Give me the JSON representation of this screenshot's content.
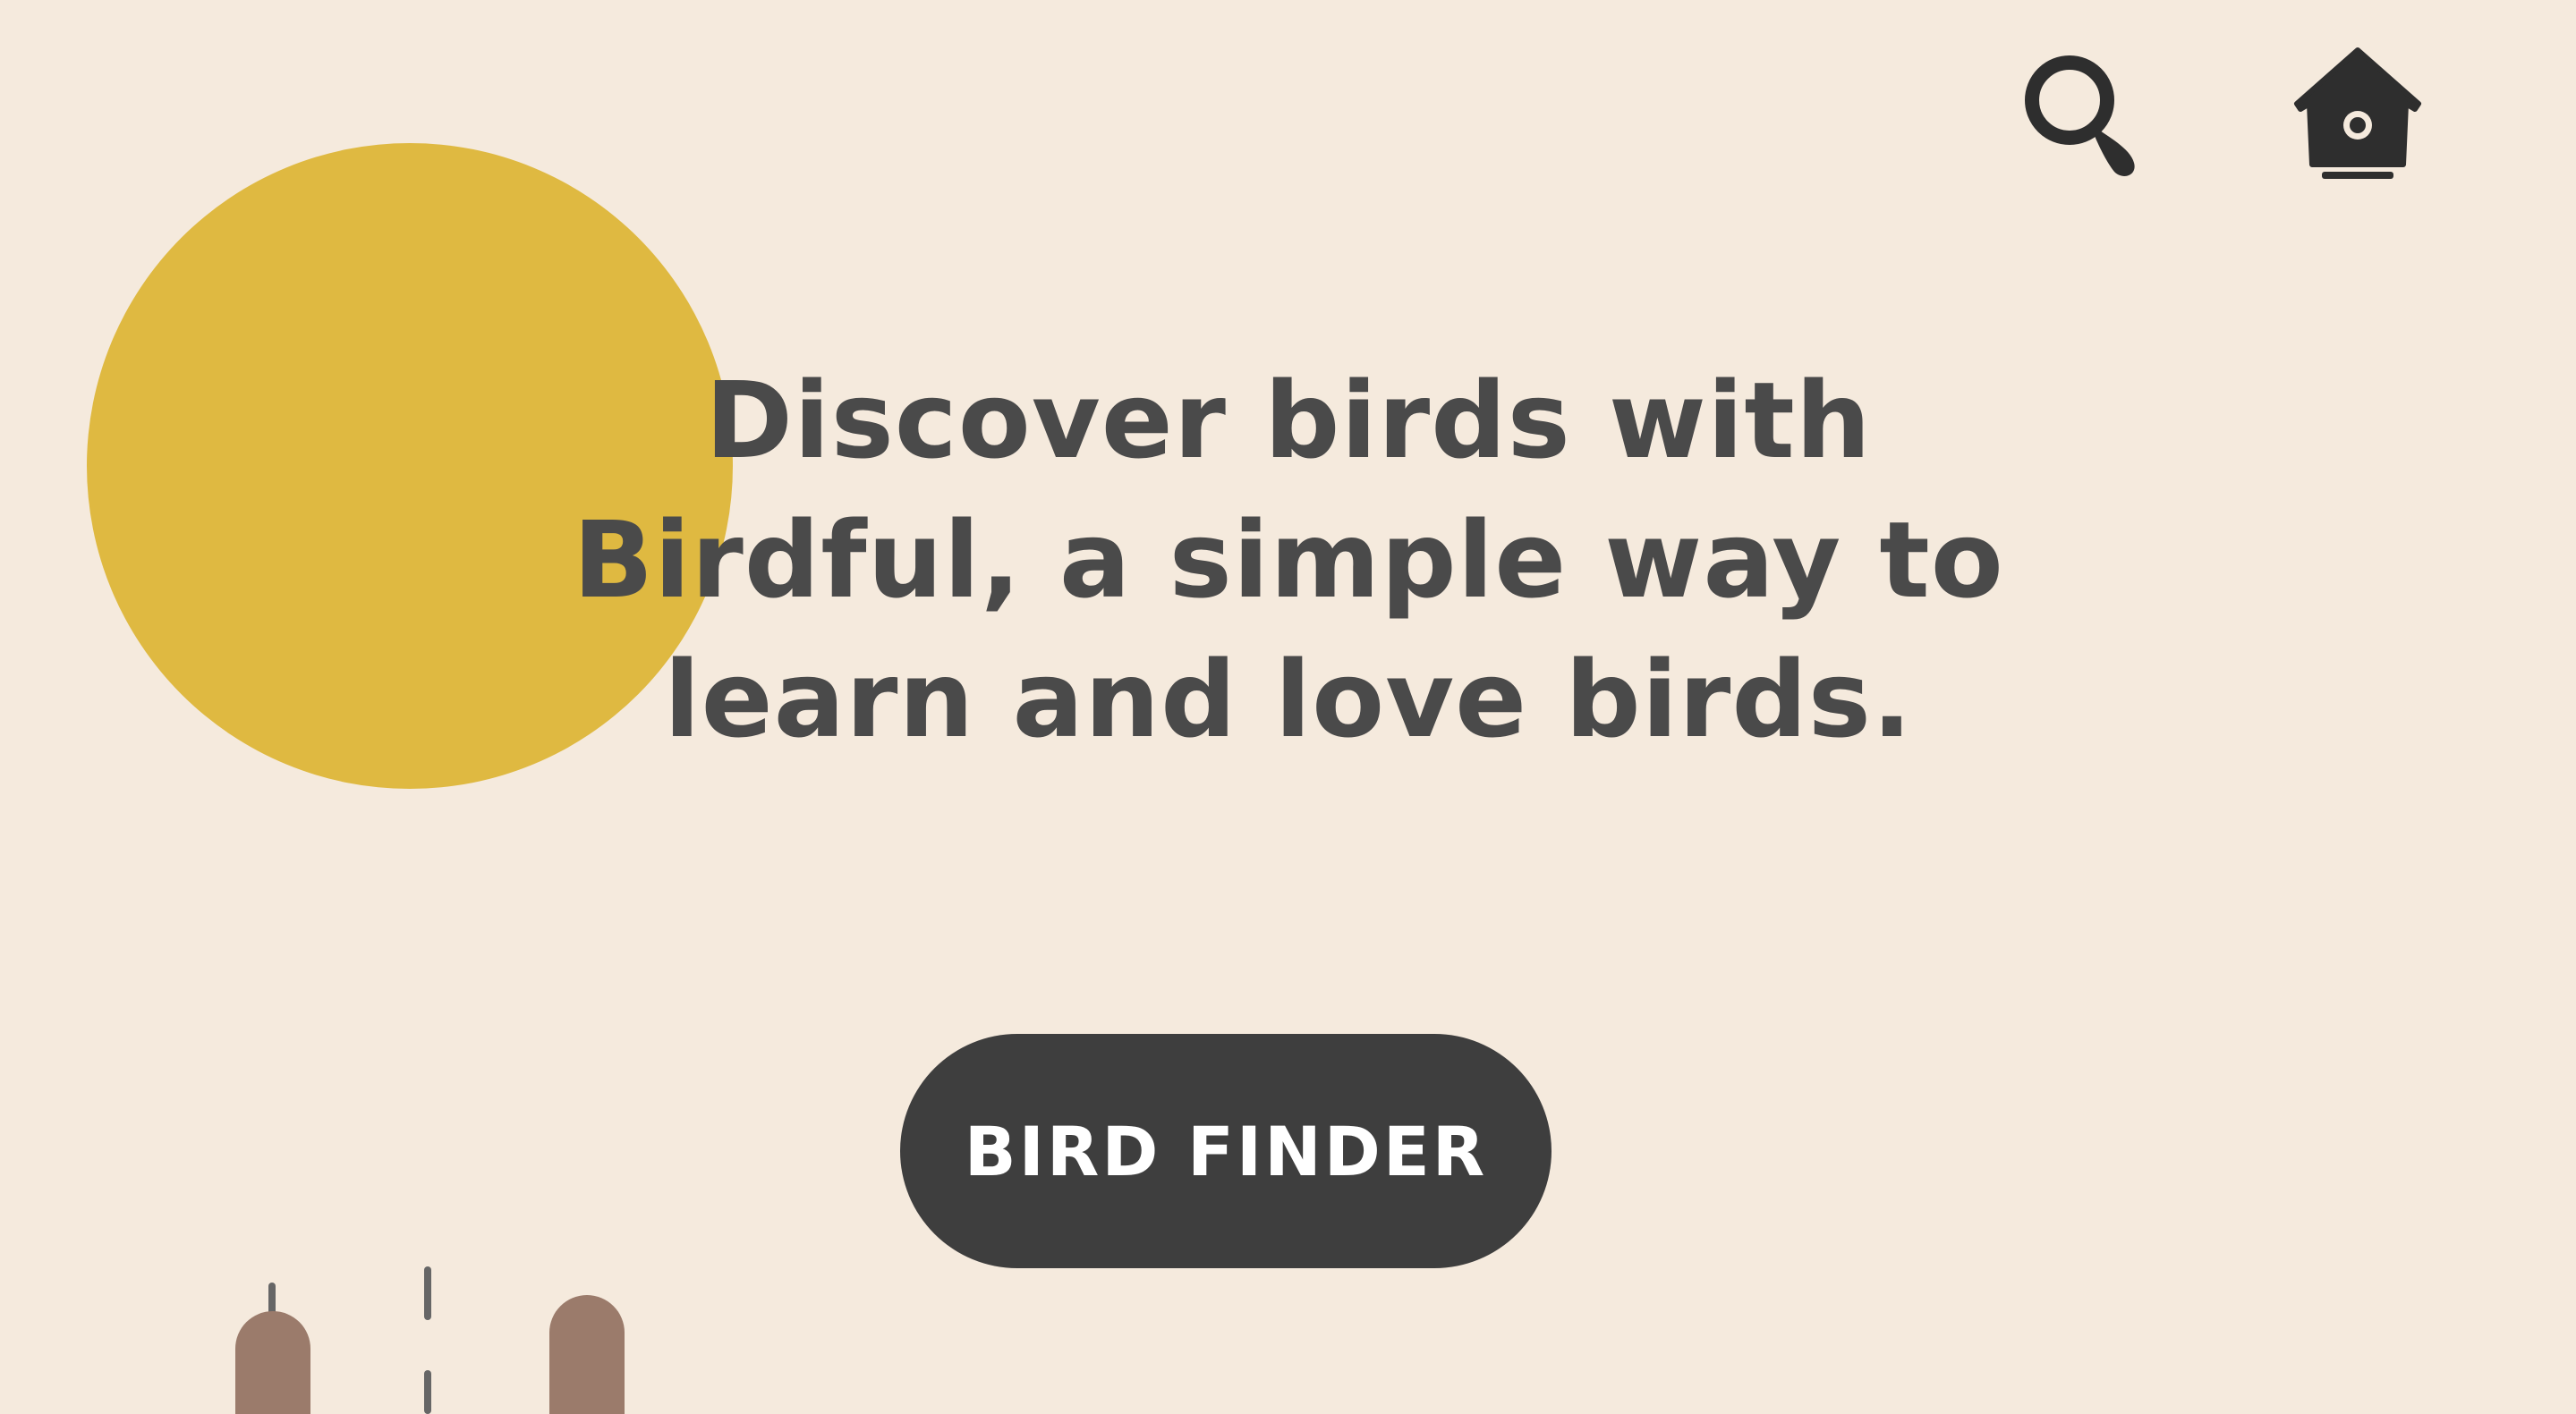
{
  "hero": {
    "text": "Discover birds with Birdful, a simple way to learn and love birds."
  },
  "cta": {
    "label": "BIRD FINDER"
  },
  "icons": {
    "search": "search-icon",
    "home": "birdhouse-icon"
  },
  "colors": {
    "background": "#f5eadd",
    "sun": "#dfb941",
    "text": "#4a4a4a",
    "button": "#3e3e3e",
    "button_text": "#ffffff",
    "cattail": "#9b7b6b",
    "stem": "#666666"
  }
}
